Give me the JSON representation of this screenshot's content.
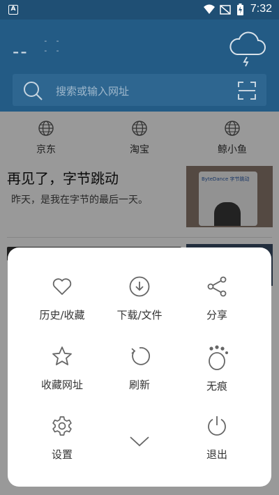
{
  "status_bar": {
    "app_badge": "A",
    "time": "7:32"
  },
  "header": {
    "temperature": "--",
    "temperature_sub": [
      "- -",
      "- -"
    ],
    "weather_icon": "thunder-cloud-icon"
  },
  "search": {
    "placeholder": "搜索或输入网址"
  },
  "quick_links": [
    {
      "label": "京东",
      "icon": "globe-icon"
    },
    {
      "label": "淘宝",
      "icon": "globe-icon"
    },
    {
      "label": "鲸小鱼",
      "icon": "globe-icon"
    }
  ],
  "news": [
    {
      "title": "再见了，字节跳动",
      "summary": "昨天，是我在字节的最后一天。",
      "thumb_text": "ByteDance 字节跳动"
    }
  ],
  "menu": {
    "items": [
      {
        "label": "历史/收藏",
        "icon": "heart-icon"
      },
      {
        "label": "下载/文件",
        "icon": "download-icon"
      },
      {
        "label": "分享",
        "icon": "share-icon"
      },
      {
        "label": "收藏网址",
        "icon": "star-icon"
      },
      {
        "label": "刷新",
        "icon": "refresh-icon"
      },
      {
        "label": "无痕",
        "icon": "paw-icon"
      },
      {
        "label": "设置",
        "icon": "gear-icon"
      },
      {
        "label": "",
        "icon": "chevron-down-icon"
      },
      {
        "label": "退出",
        "icon": "power-icon"
      }
    ]
  },
  "colors": {
    "header_bg": "#235b85",
    "status_bg": "#1f4f74",
    "icon_gray": "#666666"
  }
}
